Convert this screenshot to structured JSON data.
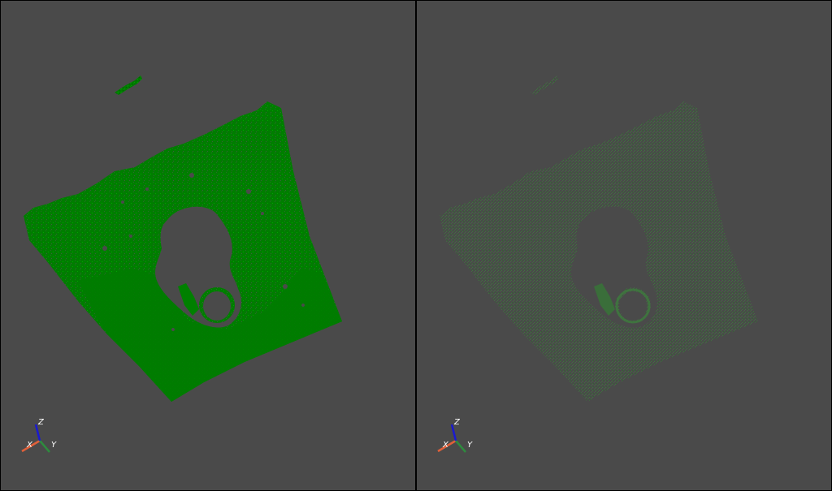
{
  "viewports": {
    "left": {
      "name": "left-viewport",
      "point_color": "#008000",
      "point_opacity": 1.0
    },
    "right": {
      "name": "right-viewport",
      "point_color": "#3f6a3f",
      "point_opacity": 0.75
    }
  },
  "axes": {
    "x_label": "X",
    "y_label": "Y",
    "z_label": "Z",
    "x_color": "#e0603a",
    "y_color": "#2e8b3e",
    "z_color": "#1a1ad0"
  },
  "colors": {
    "background": "#4a4a4a",
    "divider": "#000000"
  }
}
